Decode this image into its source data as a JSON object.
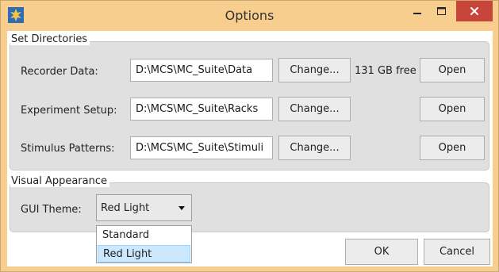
{
  "window": {
    "title": "Options"
  },
  "directories": {
    "group_label": "Set Directories",
    "rows": [
      {
        "label": "Recorder Data:",
        "path": "D:\\MCS\\MC_Suite\\Data",
        "change": "Change...",
        "free": "131 GB free",
        "open": "Open"
      },
      {
        "label": "Experiment Setup:",
        "path": "D:\\MCS\\MC_Suite\\Racks",
        "change": "Change...",
        "free": "",
        "open": "Open"
      },
      {
        "label": "Stimulus Patterns:",
        "path": "D:\\MCS\\MC_Suite\\Stimuli",
        "change": "Change...",
        "free": "",
        "open": "Open"
      }
    ]
  },
  "appearance": {
    "group_label": "Visual Appearance",
    "theme_label": "GUI Theme:",
    "theme_value": "Red Light",
    "options": [
      "Standard",
      "Red Light"
    ],
    "selected_option": "Red Light"
  },
  "footer": {
    "ok": "OK",
    "cancel": "Cancel"
  },
  "icons": {
    "app": "app-icon",
    "minimize": "minimize-icon",
    "maximize": "maximize-icon",
    "close": "close-icon",
    "dropdown": "chevron-down-icon"
  },
  "colors": {
    "title_bar": "#f7ce8e",
    "close_button": "#c7453b",
    "group_background": "#e0e0e0",
    "selected_item": "#cce8ff"
  }
}
